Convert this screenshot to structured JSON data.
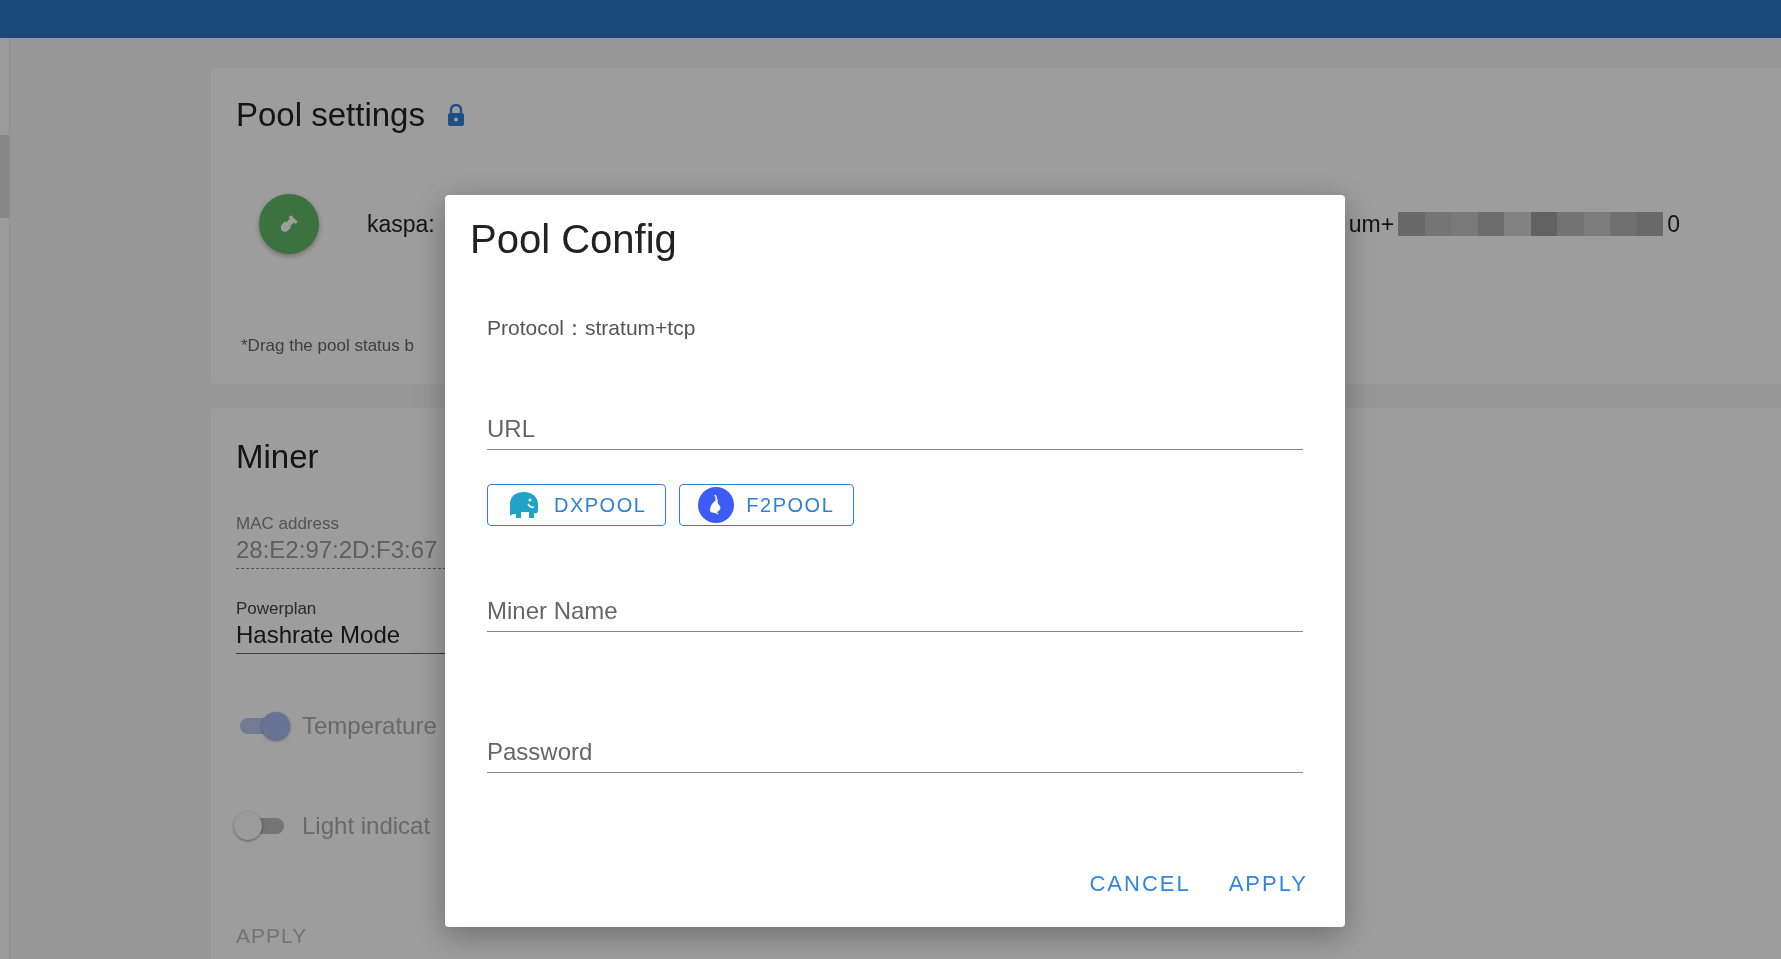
{
  "pool_settings": {
    "title": "Pool settings",
    "locked": true,
    "pool": {
      "worker": "kaspa:",
      "url_start": "um+",
      "url_end": "0",
      "redacted": true
    },
    "hint": "*Drag the pool status b"
  },
  "miner": {
    "title": "Miner",
    "mac_address": {
      "label": "MAC address",
      "value": "28:E2:97:2D:F3:67"
    },
    "powerplan": {
      "label": "Powerplan",
      "value": "Hashrate Mode"
    },
    "toggles": [
      {
        "label": "Temperature",
        "on": true
      },
      {
        "label": "Light indicat",
        "on": false
      }
    ],
    "apply": "APPLY"
  },
  "dialog": {
    "title": "Pool Config",
    "protocol": "Protocol：stratum+tcp",
    "url_field": {
      "placeholder": "URL"
    },
    "presets": [
      {
        "label": "DXPOOL",
        "kind": "elephant"
      },
      {
        "label": "F2POOL",
        "kind": "fish"
      }
    ],
    "fields": [
      {
        "placeholder": "Miner Name"
      },
      {
        "placeholder": "Password"
      }
    ],
    "buttons": [
      "CANCEL",
      "APPLY"
    ]
  }
}
